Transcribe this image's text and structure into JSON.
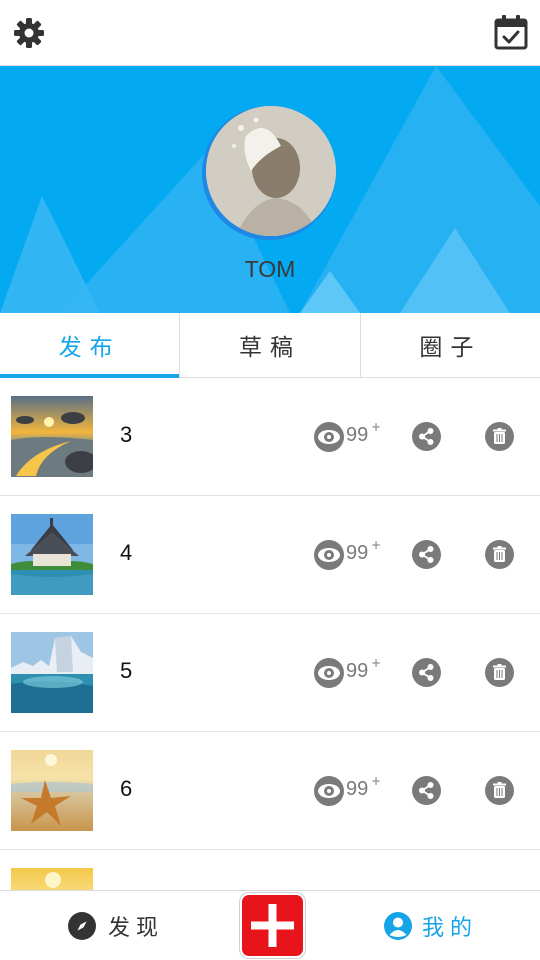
{
  "topbar": {
    "left_icon": "gear-icon",
    "right_icon": "calendar-check-icon"
  },
  "profile": {
    "username": "TOM",
    "background_color": "#03a9f1"
  },
  "tabs": [
    {
      "label": "发布",
      "active": true
    },
    {
      "label": "草稿",
      "active": false
    },
    {
      "label": "圈子",
      "active": false
    }
  ],
  "posts": [
    {
      "number": "3",
      "views": "99",
      "views_suffix": "+",
      "thumb": "beach-sunset"
    },
    {
      "number": "4",
      "views": "99",
      "views_suffix": "+",
      "thumb": "temple-lake"
    },
    {
      "number": "5",
      "views": "99",
      "views_suffix": "+",
      "thumb": "iceberg"
    },
    {
      "number": "6",
      "views": "99",
      "views_suffix": "+",
      "thumb": "starfish-beach"
    },
    {
      "number": "",
      "views": "",
      "views_suffix": "",
      "thumb": "sunset-sea"
    }
  ],
  "bottom_nav": {
    "discover_label": "发现",
    "mine_label": "我的",
    "add_icon": "plus-icon"
  },
  "colors": {
    "accent": "#16a4e8",
    "add_button": "#e8141c",
    "icon_gray": "#7a7a7a"
  }
}
